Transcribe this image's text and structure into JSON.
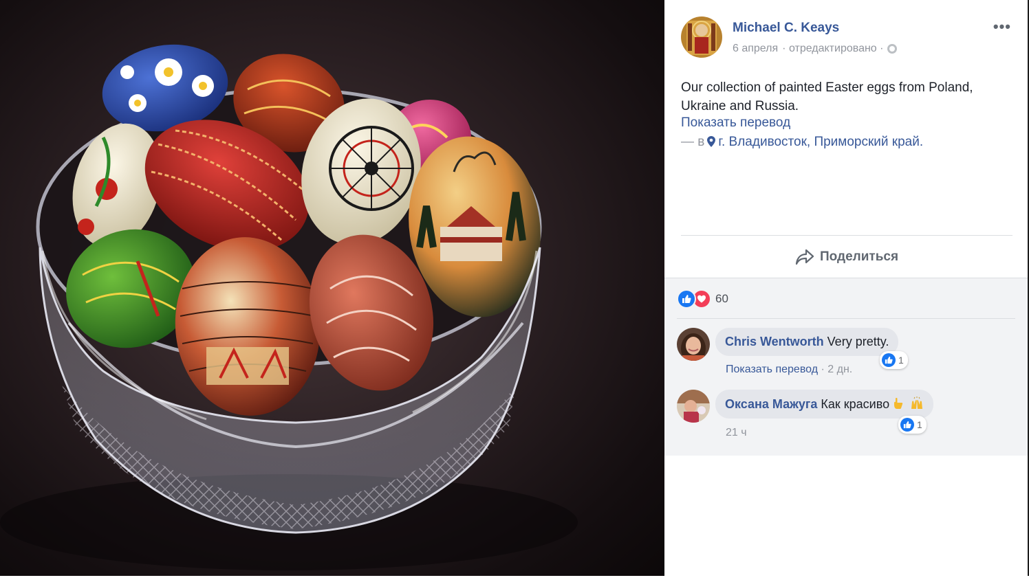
{
  "post": {
    "author": "Michael C. Keays",
    "date": "6 апреля",
    "edited": "· отредактировано ·",
    "more_icon": "more-icon",
    "text": "Our collection of painted Easter eggs from Poland, Ukraine and Russia.",
    "translate": "Показать перевод",
    "location_prefix": "— в",
    "location": "г. Владивосток, Приморский край.",
    "share_label": "Поделиться",
    "reactions_count": "60"
  },
  "comments": [
    {
      "author": "Chris Wentworth",
      "text": "Very pretty.",
      "translate": "Показать перевод",
      "time": "· 2 дн.",
      "likes": "1"
    },
    {
      "author": "Оксана Мажуга",
      "text": "Как красиво",
      "time": "21 ч",
      "likes": "1"
    }
  ],
  "colors": {
    "link": "#385898",
    "meta": "#90949c",
    "like": "#1877f2",
    "love": "#f33e58",
    "feedback_bg": "#f2f3f5"
  }
}
